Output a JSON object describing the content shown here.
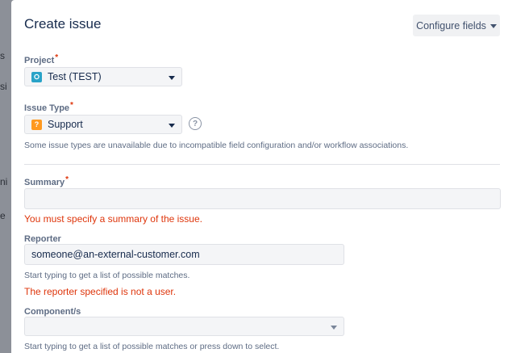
{
  "dialog": {
    "title": "Create issue",
    "configure_fields_label": "Configure fields"
  },
  "project": {
    "label": "Project",
    "required_mark": "*",
    "value": "Test (TEST)"
  },
  "issue_type": {
    "label": "Issue Type",
    "required_mark": "*",
    "value": "Support",
    "icon_glyph": "?",
    "help_glyph": "?",
    "note": "Some issue types are unavailable due to incompatible field configuration and/or workflow associations."
  },
  "summary": {
    "label": "Summary",
    "required_mark": "*",
    "value": "",
    "error": "You must specify a summary of the issue."
  },
  "reporter": {
    "label": "Reporter",
    "value": "someone@an-external-customer.com",
    "help": "Start typing to get a list of possible matches.",
    "error": "The reporter specified is not a user."
  },
  "components": {
    "label": "Component/s",
    "value": "",
    "help": "Start typing to get a list of possible matches or press down to select."
  },
  "colors": {
    "error": "#de350b",
    "project_icon": "#2aa3c8",
    "support_icon": "#ff991f"
  },
  "background_fragments": [
    "s",
    "si",
    "ni",
    "e"
  ]
}
